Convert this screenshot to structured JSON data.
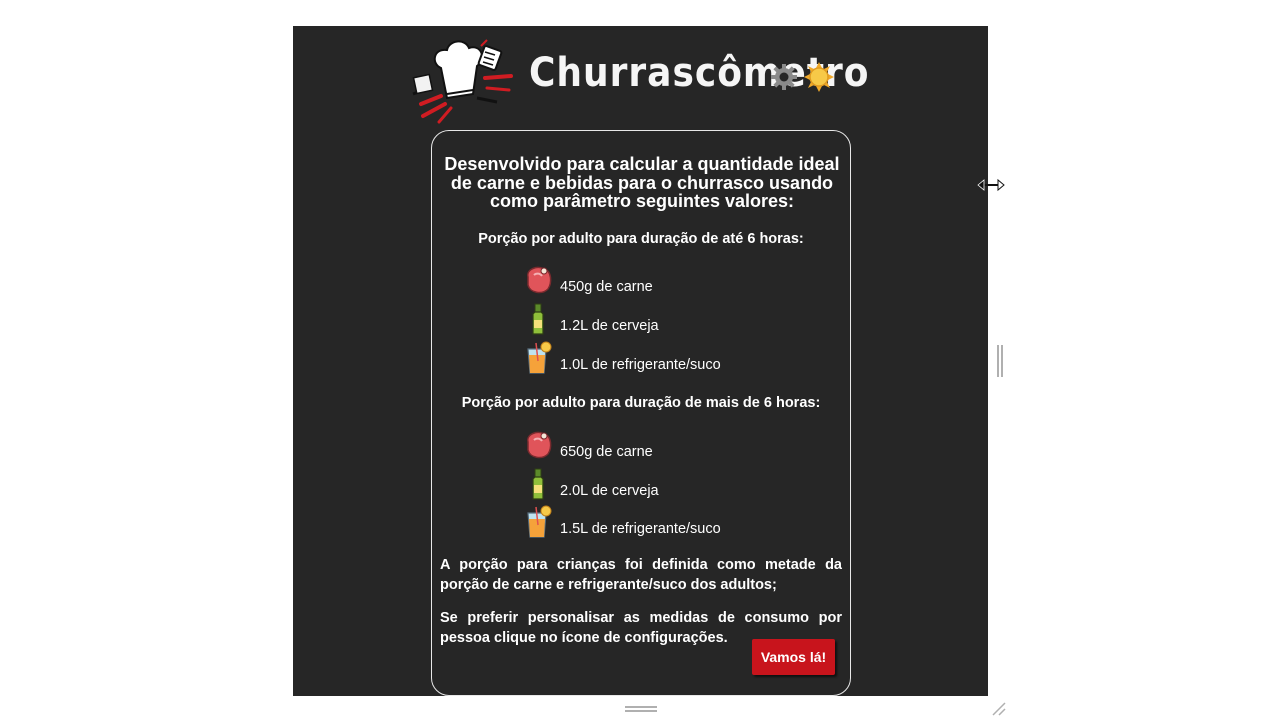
{
  "app": {
    "title": "Churrascômetro"
  },
  "header": {
    "logo_icon": "chef-hat-grill-tools-icon",
    "settings_icon": "gear-icon",
    "theme_icon": "sun-icon"
  },
  "card": {
    "intro": "Desenvolvido para calcular a quantidade ideal de carne e bebidas para o churrasco usando como parâmetro seguintes valores:",
    "section_short": {
      "label": "Porção por adulto para duração de até 6 horas:",
      "items": [
        {
          "icon": "meat-icon",
          "text": "450g de carne"
        },
        {
          "icon": "beer-bottle-icon",
          "text": "1.2L de cerveja"
        },
        {
          "icon": "juice-glass-icon",
          "text": "1.0L de refrigerante/suco"
        }
      ]
    },
    "section_long": {
      "label": "Porção por adulto para duração de mais de 6 horas:",
      "items": [
        {
          "icon": "meat-icon",
          "text": "650g de carne"
        },
        {
          "icon": "beer-bottle-icon",
          "text": "2.0L de cerveja"
        },
        {
          "icon": "juice-glass-icon",
          "text": "1.5L de refrigerante/suco"
        }
      ]
    },
    "note_children": "A porção para crianças foi definida como metade da porção de carne e refrigerante/suco dos adultos;",
    "note_settings": "Se preferir personalisar as medidas de consumo por pessoa clique no ícone de configurações.",
    "button_label": "Vamos lá!"
  },
  "colors": {
    "background": "#262626",
    "accent": "#c8141c",
    "text": "#ffffff"
  }
}
